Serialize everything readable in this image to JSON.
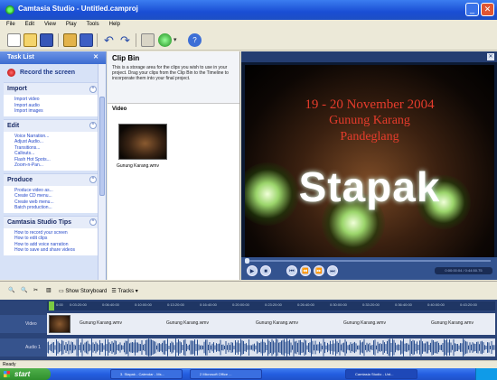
{
  "window": {
    "title": "Camtasia Studio - Untitled.camproj"
  },
  "menu": [
    "File",
    "Edit",
    "View",
    "Play",
    "Tools",
    "Help"
  ],
  "toolbar": {
    "icons": [
      "new-project-icon",
      "open-project-icon",
      "save-icon",
      "import-icon",
      "produce-icon",
      "undo-icon",
      "redo-icon",
      "view-icon",
      "record-green-icon",
      "help-icon"
    ]
  },
  "task_list": {
    "title": "Task List",
    "record_label": "Record the screen",
    "sections": [
      {
        "title": "Import",
        "links": [
          "Import video",
          "Import audio",
          "Import images"
        ]
      },
      {
        "title": "Edit",
        "links": [
          "Voice Narration...",
          "Adjust Audio...",
          "Transitions...",
          "Callouts...",
          "Flash Hot Spots...",
          "Zoom-n-Pan..."
        ]
      },
      {
        "title": "Produce",
        "links": [
          "Produce video as...",
          "Create CD menu...",
          "Create web menu...",
          "Batch production..."
        ]
      },
      {
        "title": "Camtasia Studio Tips",
        "links": [
          "How to record your screen",
          "How to edit clips",
          "How to add voice narration",
          "How to save and share videos"
        ]
      }
    ]
  },
  "clip_bin": {
    "title": "Clip Bin",
    "description": "This is a storage area for the clips you wish to use in your project. Drag your clips from the Clip Bin to the Timeline to incorporate them into your final project.",
    "section_label": "Video",
    "clip_name": "Gunung Karang.wmv"
  },
  "preview": {
    "line1": "19 - 20 November 2004",
    "line2": "Gunung Karang",
    "line3": "Pandeglang",
    "big_text": "Stapak",
    "timecode": "0:00:00:04 / 0:44:50.75"
  },
  "timeline_toolbar": {
    "show_storyboard": "Show Storyboard",
    "tracks": "Tracks"
  },
  "timeline": {
    "ruler": [
      "0:00",
      "0:03:20:00",
      "0:06:40:00",
      "0:10:00:00",
      "0:13:20:00",
      "0:16:40:00",
      "0:20:00:00",
      "0:23:20:00",
      "0:26:40:00",
      "0:30:00:00",
      "0:33:20:00",
      "0:36:40:00",
      "0:40:00:00",
      "0:43:20:00"
    ],
    "video_label": "Video",
    "audio_label": "Audio 1",
    "clip_labels": [
      "Gunung Karang.wmv",
      "Gunung Karang.wmv",
      "Gunung Karang.wmv",
      "Gunung Karang.wmv",
      "Gunung Karang.wmv"
    ]
  },
  "status": "Ready",
  "taskbar": {
    "start": "start",
    "items": [
      "3. Stapak - Calendar - Ms...",
      "2 Microsoft Office ...",
      "Camtasia Studio - Unt..."
    ]
  },
  "colors": {
    "title_blue": "#1a4ed4",
    "task_panel": "#d7e2f7",
    "timeline_bg": "#2b4478",
    "accent_green": "#7ac943"
  }
}
